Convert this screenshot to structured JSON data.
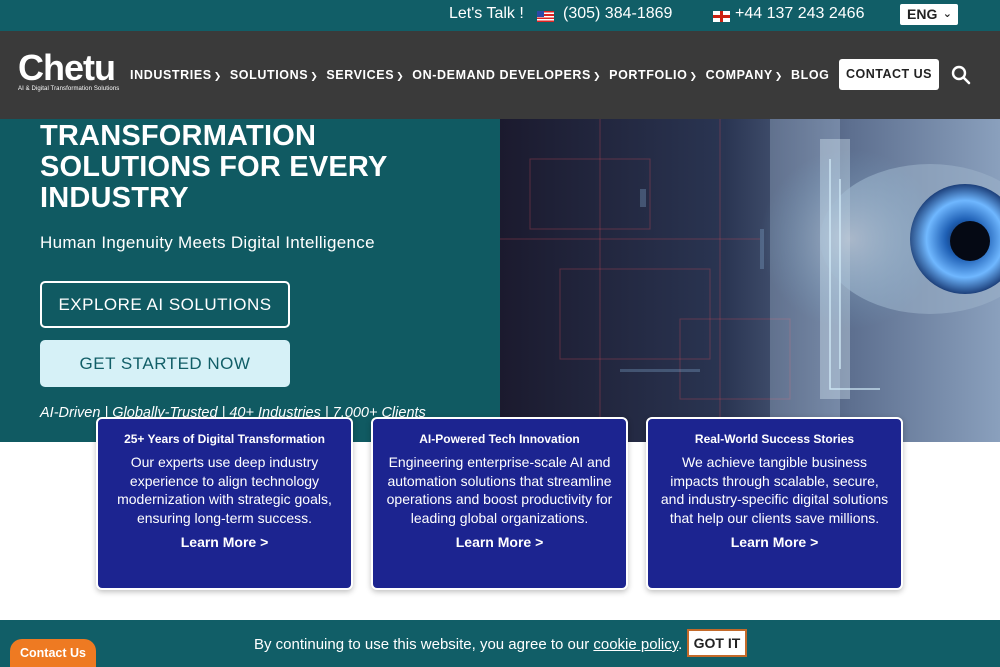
{
  "topbar": {
    "talk": "Let's Talk !",
    "us_flag_icon": "us-flag-icon",
    "phone_us": "(305) 384-1869",
    "uk_flag_icon": "uk-flag-icon",
    "phone_uk": "+44 137 243 2466",
    "language": "ENG",
    "colors": {
      "background": "#115e67"
    }
  },
  "nav": {
    "logo": "Chetu",
    "logo_tagline": "AI & Digital Transformation Solutions",
    "items": [
      {
        "label": "INDUSTRIES",
        "dropdown": true
      },
      {
        "label": "SOLUTIONS",
        "dropdown": true
      },
      {
        "label": "SERVICES",
        "dropdown": true
      },
      {
        "label": "ON-DEMAND DEVELOPERS",
        "dropdown": true
      },
      {
        "label": "PORTFOLIO",
        "dropdown": true
      },
      {
        "label": "COMPANY",
        "dropdown": true
      },
      {
        "label": "BLOG",
        "dropdown": false
      }
    ],
    "contact_label": "CONTACT US",
    "search_icon": "search-icon",
    "colors": {
      "background": "#3a3a3a"
    }
  },
  "hero": {
    "title": "TRANSFORMATION SOLUTIONS FOR EVERY INDUSTRY",
    "subtitle": "Human Ingenuity Meets Digital Intelligence",
    "explore_label": "EXPLORE AI SOLUTIONS",
    "start_label": "GET STARTED NOW",
    "stats": "AI-Driven | Globally-Trusted | 40+ Industries | 7,000+ Clients",
    "colors": {
      "background": "#105a62",
      "start_button": "#d6f1f7"
    }
  },
  "cards": [
    {
      "title": "25+ Years of Digital Transformation",
      "body": "Our experts use deep industry experience to align technology modernization with strategic goals, ensuring long-term success.",
      "link": "Learn More >"
    },
    {
      "title": "AI-Powered Tech Innovation",
      "body": "Engineering enterprise-scale AI and automation solutions that streamline operations and boost productivity for leading global organizations.",
      "link": "Learn More >"
    },
    {
      "title": "Real-World Success Stories",
      "body": "We achieve tangible business impacts through scalable, secure, and industry-specific digital solutions that help our clients save millions.",
      "link": "Learn More >"
    }
  ],
  "cookie": {
    "message_prefix": "By continuing to use this website, you agree to our",
    "link": "cookie policy",
    "message_suffix": ".",
    "button": "GOT IT"
  },
  "contact_tab": "Contact Us",
  "colors": {
    "card_background": "#1c2490",
    "contact_tab": "#ee7a22"
  }
}
